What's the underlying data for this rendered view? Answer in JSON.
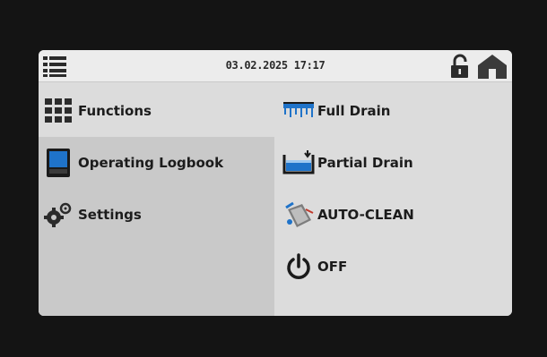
{
  "header": {
    "datetime": "03.02.2025 17:17",
    "icons": {
      "menu": "list-menu-icon",
      "lock": "unlocked-padlock-icon",
      "home": "home-icon"
    }
  },
  "left_menu": {
    "items": [
      {
        "label": "Functions",
        "icon": "grid-icon",
        "active": false
      },
      {
        "label": "Operating Logbook",
        "icon": "logbook-icon",
        "active": true
      },
      {
        "label": "Settings",
        "icon": "gears-icon",
        "active": false
      }
    ]
  },
  "actions": {
    "items": [
      {
        "label": "Full Drain",
        "icon": "full-drain-icon"
      },
      {
        "label": "Partial Drain",
        "icon": "partial-drain-icon"
      },
      {
        "label": "AUTO-CLEAN",
        "icon": "auto-clean-icon"
      },
      {
        "label": "OFF",
        "icon": "power-icon"
      }
    ]
  },
  "colors": {
    "background": "#141414",
    "screen": "#dcdcdc",
    "header": "#ececec",
    "active_panel": "#c9c9c9",
    "accent_blue": "#1f73c9",
    "text": "#1c1c1c"
  }
}
